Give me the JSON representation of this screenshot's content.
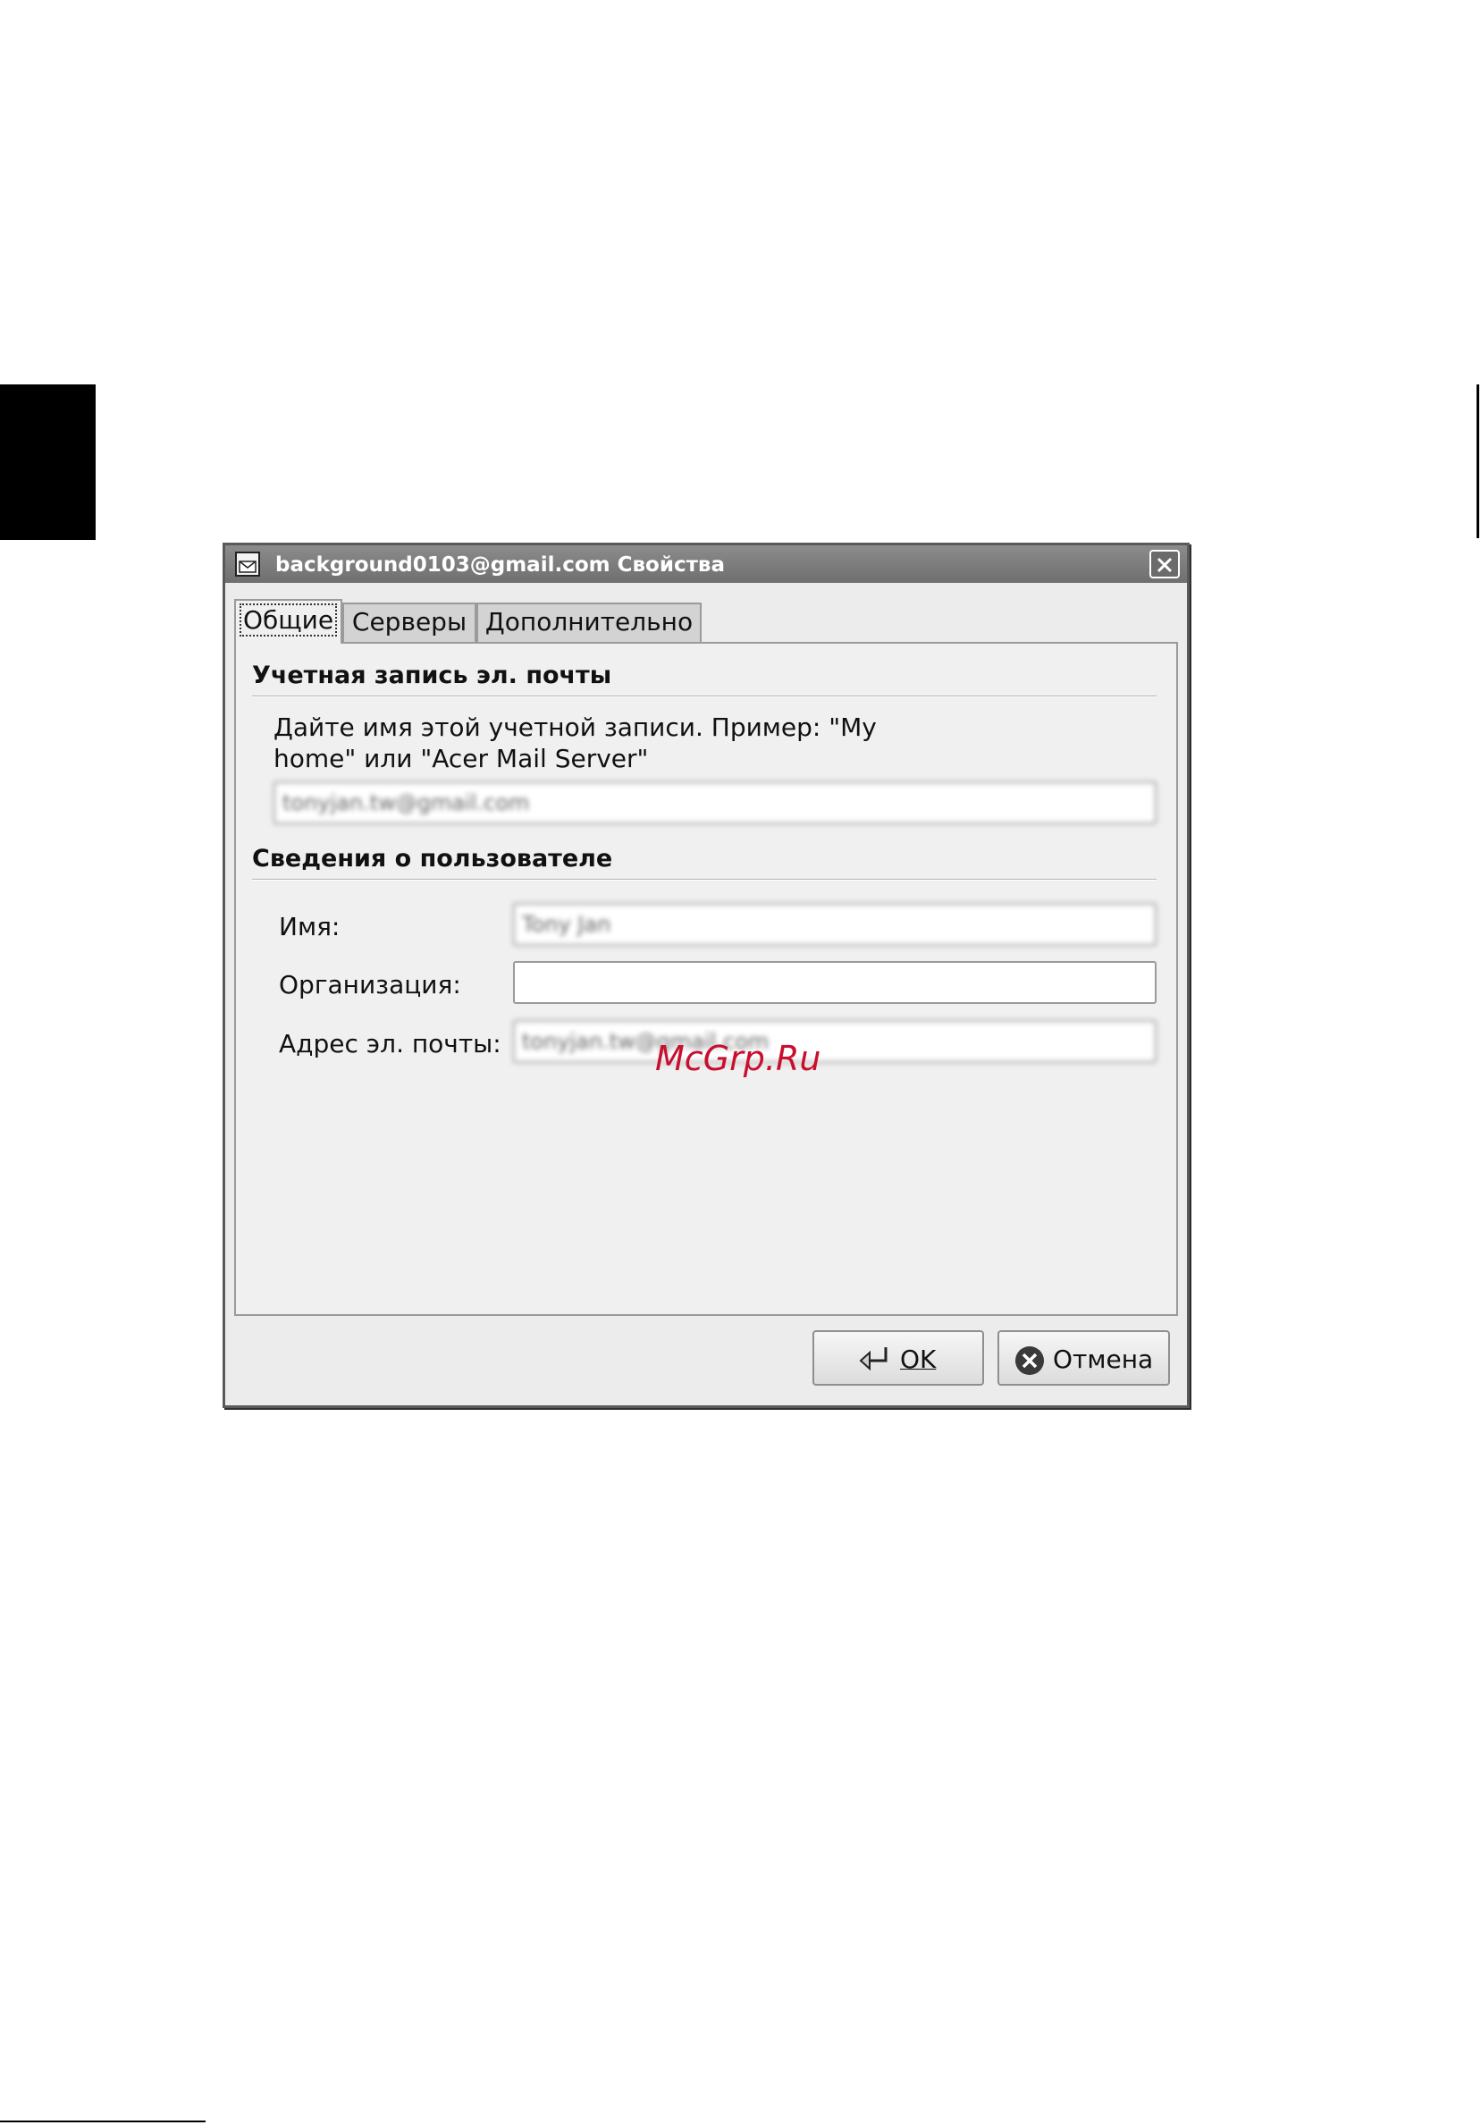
{
  "window": {
    "title": "background0103@gmail.com Свойства",
    "icon": "mail-icon",
    "close_icon": "close-icon"
  },
  "tabs": [
    {
      "label": "Общие",
      "active": true
    },
    {
      "label": "Серверы",
      "active": false
    },
    {
      "label": "Дополнительно",
      "active": false
    }
  ],
  "account_section": {
    "header": "Учетная запись эл. почты",
    "description": "Дайте имя этой учетной записи. Пример: \"My home\" или \"Acer Mail Server\"",
    "account_name_value": "tonyjan.tw@gmail.com"
  },
  "user_section": {
    "header": "Сведения о пользователе",
    "name_label": "Имя:",
    "name_value": "Tony Jan",
    "org_label": "Организация:",
    "org_value": "",
    "email_label": "Адрес эл. почты:",
    "email_value": "tonyjan.tw@gmail.com"
  },
  "buttons": {
    "ok_label": "OK",
    "cancel_label": "Отмена"
  },
  "watermark": "McGrp.Ru"
}
